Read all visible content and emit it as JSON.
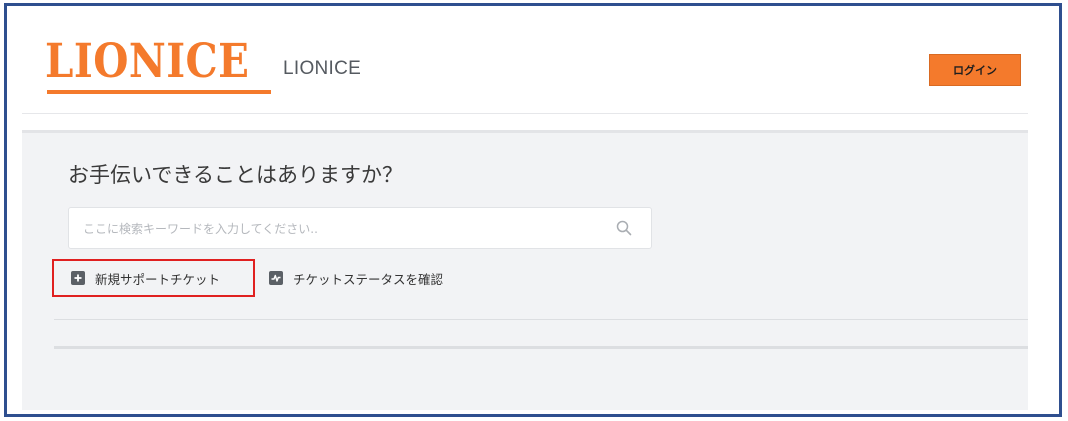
{
  "header": {
    "logo_text": "LIONICE",
    "brand_name": "LIONICE",
    "login_label": "ログイン"
  },
  "main": {
    "title": "お手伝いできることはありますか？",
    "search": {
      "placeholder": "ここに検索キーワードを入力してください..",
      "value": ""
    },
    "actions": {
      "new_ticket": "新規サポートチケット",
      "check_status": "チケットステータスを確認"
    }
  },
  "icons": {
    "search": "search-icon",
    "new_ticket": "plus-square-icon",
    "check_status": "activity-square-icon"
  },
  "colors": {
    "brand": "#f47a2c",
    "frame_border": "#2f4f8f",
    "highlight_box": "#e02020",
    "background": "#f2f3f5"
  }
}
